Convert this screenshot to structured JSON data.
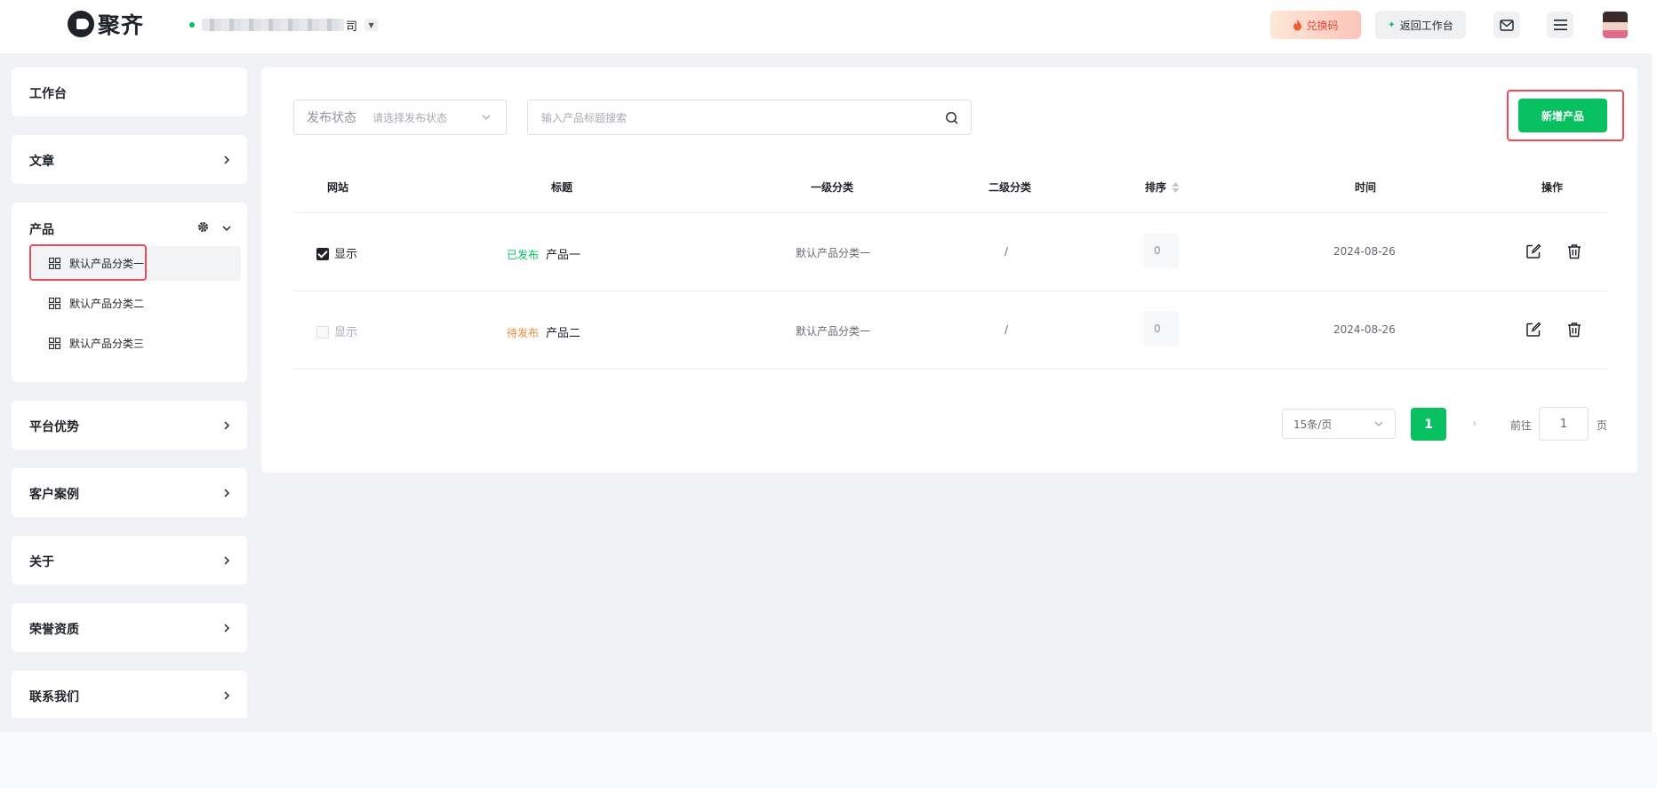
{
  "brand": {
    "name": "聚齐",
    "accent": "#07c160"
  },
  "header": {
    "company_suffix": "司",
    "redeem_label": "兑换码",
    "back_label": "返回工作台"
  },
  "sidebar": {
    "workbench": "工作台",
    "articles": "文章",
    "products": {
      "label": "产品",
      "items": [
        "默认产品分类一",
        "默认产品分类二",
        "默认产品分类三"
      ],
      "active_index": 0
    },
    "advantages": "平台优势",
    "cases": "客户案例",
    "about": "关于",
    "honors": "荣誉资质",
    "contact": "联系我们"
  },
  "filters": {
    "status_label": "发布状态",
    "status_placeholder": "请选择发布状态",
    "search_placeholder": "输入产品标题搜索",
    "add_button": "新增产品"
  },
  "table": {
    "columns": [
      "网站",
      "标题",
      "一级分类",
      "二级分类",
      "排序",
      "时间",
      "操作"
    ],
    "rows": [
      {
        "site_checked": true,
        "site": "显示",
        "status": "已发布",
        "title": "产品一",
        "cat1": "默认产品分类一",
        "cat2": "/",
        "order": "0",
        "date": "2024-08-26"
      },
      {
        "site_checked": false,
        "site": "显示",
        "status": "待发布",
        "title": "产品二",
        "cat1": "默认产品分类一",
        "cat2": "/",
        "order": "0",
        "date": "2024-08-26"
      }
    ]
  },
  "pagination": {
    "page_size": "15条/页",
    "current_page": "1",
    "goto_label": "前往",
    "goto_value": "1",
    "goto_suffix": "页"
  }
}
